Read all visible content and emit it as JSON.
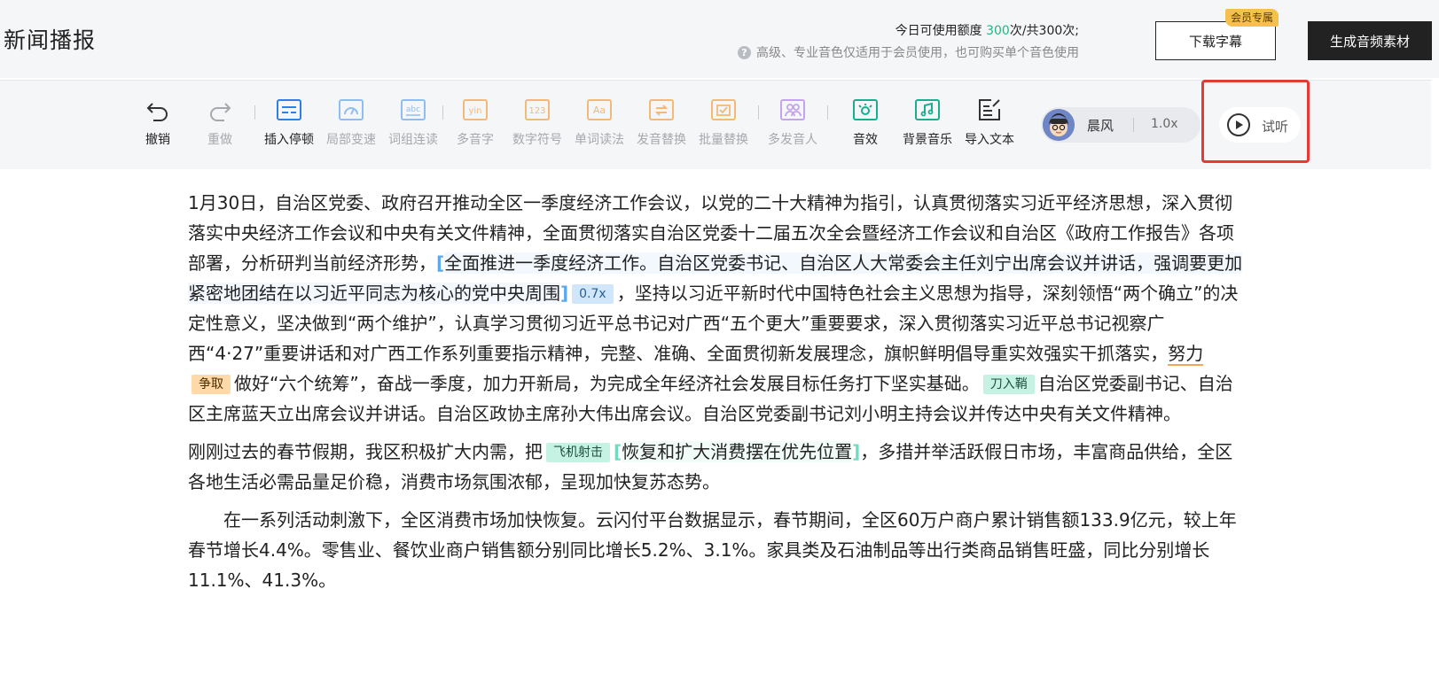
{
  "header": {
    "title": "新闻播报",
    "quota_prefix": "今日可使用额度 ",
    "quota_used": "300",
    "quota_suffix": "次/共300次;",
    "vip_note": "高级、专业音色仅适用于会员使用，也可购买单个音色使用",
    "download_subtitle": "下载字幕",
    "vip_badge": "会员专属",
    "generate_audio": "生成音频素材"
  },
  "toolbar": {
    "undo": "撤销",
    "redo": "重做",
    "insert_pause": "插入停顿",
    "local_speed": "局部变速",
    "word_group": "词组连读",
    "polyphone": "多音字",
    "digit_symbol": "数字符号",
    "word_reading": "单词读法",
    "pronunciation_replace": "发音替换",
    "batch_replace": "批量替换",
    "multi_speaker": "多发音人",
    "sound_effect": "音效",
    "bgm": "背景音乐",
    "import_text": "导入文本",
    "voice_name": "晨风",
    "voice_speed": "1.0x",
    "preview": "试听"
  },
  "colors": {
    "accent_green": "#1db981",
    "highlight_red": "#e53935",
    "dark_button": "#222222"
  },
  "article": {
    "p1_a": "1月30日，自治区党委、政府召开推动全区一季度经济工作会议，以党的二十大精神为指引，认真贯彻落实习近平经济思想，深入贯彻落实中央经济工作会议和中央有关文件精神，全面贯彻落实自治区党委十二届五次全会暨经济工作会议和自治区《政府工作报告》各项部署，分析研判当前经济形势，",
    "p1_bracket_open": "[",
    "p1_speed_text": "全面推进一季度经济工作。自治区党委书记、自治区人大常委会主任刘宁出席会议并讲话，强调要更加紧密地团结在以习近平同志为核心的党中央周围",
    "p1_bracket_close": "]",
    "p1_speed_tag": "0.7x",
    "p1_b": "，坚持以习近平新时代中国特色社会主义思想为指导，深刻领悟“两个确立”的决定性意义，坚决做到“两个维护”，认真学习贯彻习近平总书记对广西“五个更大”重要要求，深入贯彻落实习近平总书记视察广西“4·27”重要讲话和对广西工作系列重要指示精神，完整、准确、全面贯彻新发展理念，旗帜鲜明倡导重实效强实干抓落实，",
    "p1_replace_word": "努力",
    "p1_replace_tag": "争取",
    "p1_c": "做好“六个统筹”，奋战一季度，加力开新局，为完成全年经济社会发展目标任务打下坚实基础。",
    "p1_sfx_tag": "刀入鞘",
    "p1_d": "自治区党委副书记、自治区主席蓝天立出席会议并讲话。自治区政协主席孙大伟出席会议。自治区党委副书记刘小明主持会议并传达中央有关文件精神。",
    "p2_a": "刚刚过去的春节假期，我区积极扩大内需，把",
    "p2_sfx_tag": "飞机射击",
    "p2_bracket_open": "[",
    "p2_group_text": "恢复和扩大消费摆在优先位置",
    "p2_bracket_close": "]",
    "p2_b": "，多措并举活跃假日市场，丰富商品供给，全区各地生活必需品量足价稳，消费市场氛围浓郁，呈现加快复苏态势。",
    "p3": "在一系列活动刺激下，全区消费市场加快恢复。云闪付平台数据显示，春节期间，全区60万户商户累计销售额133.9亿元，较上年春节增长4.4%。零售业、餐饮业商户销售额分别同比增长5.2%、3.1%。家具类及石油制品等出行类商品销售旺盛，同比分别增长11.1%、41.3%。"
  }
}
